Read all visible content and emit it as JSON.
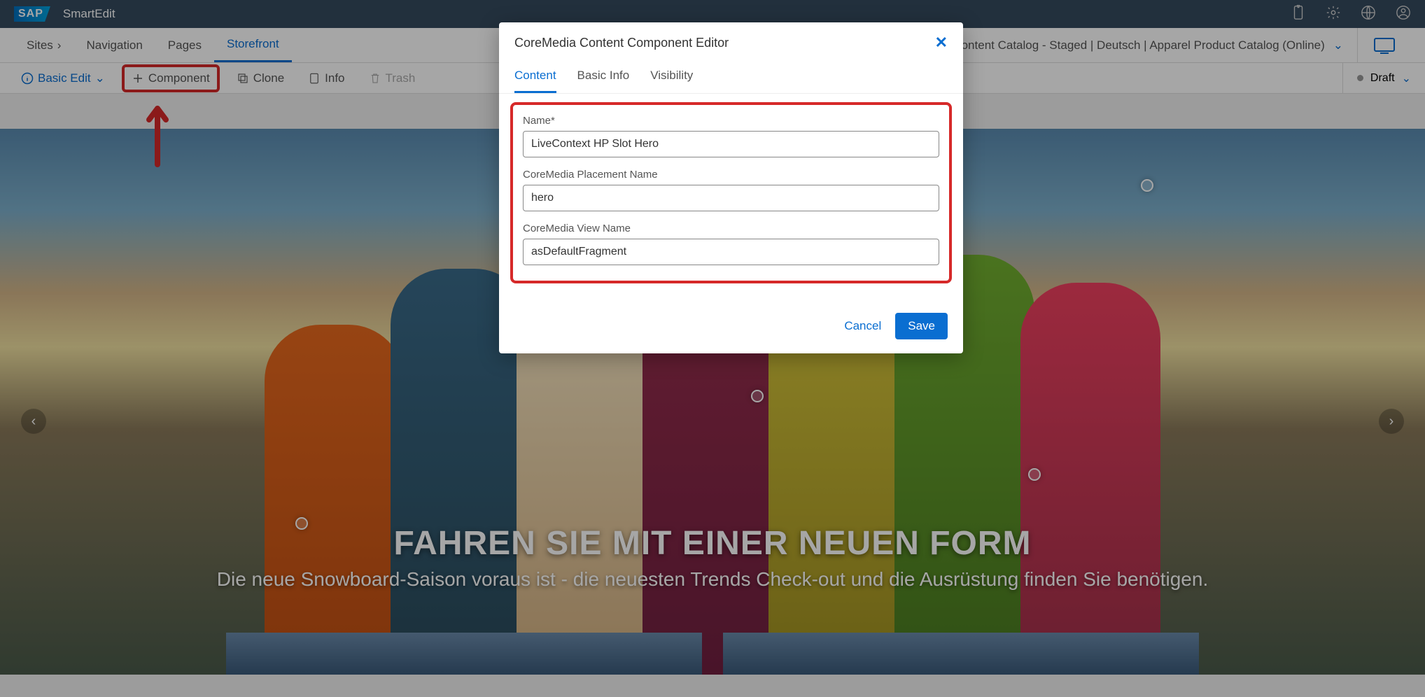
{
  "header": {
    "app_title": "SmartEdit",
    "logo_text": "SAP"
  },
  "nav": {
    "items": [
      {
        "label": "Sites",
        "has_chevron": true
      },
      {
        "label": "Navigation"
      },
      {
        "label": "Pages"
      },
      {
        "label": "Storefront",
        "active": true
      }
    ],
    "catalog_label": "Apparel DE Content Catalog - Staged | Deutsch | Apparel Product Catalog (Online)"
  },
  "toolbar": {
    "mode_label": "Basic Edit",
    "component_label": "Component",
    "clone_label": "Clone",
    "info_label": "Info",
    "trash_label": "Trash",
    "status_label": "Draft"
  },
  "hero": {
    "title": "FAHREN SIE MIT EINER NEUEN FORM",
    "subtitle": "Die neue Snowboard-Saison voraus ist - die neuesten Trends Check-out und die Ausrüstung finden Sie benötigen."
  },
  "modal": {
    "title": "CoreMedia Content Component Editor",
    "tabs": [
      {
        "label": "Content",
        "active": true
      },
      {
        "label": "Basic Info"
      },
      {
        "label": "Visibility"
      }
    ],
    "fields": {
      "name_label": "Name*",
      "name_value": "LiveContext HP Slot Hero",
      "placement_label": "CoreMedia Placement Name",
      "placement_value": "hero",
      "view_label": "CoreMedia View Name",
      "view_value": "asDefaultFragment"
    },
    "cancel_label": "Cancel",
    "save_label": "Save"
  }
}
